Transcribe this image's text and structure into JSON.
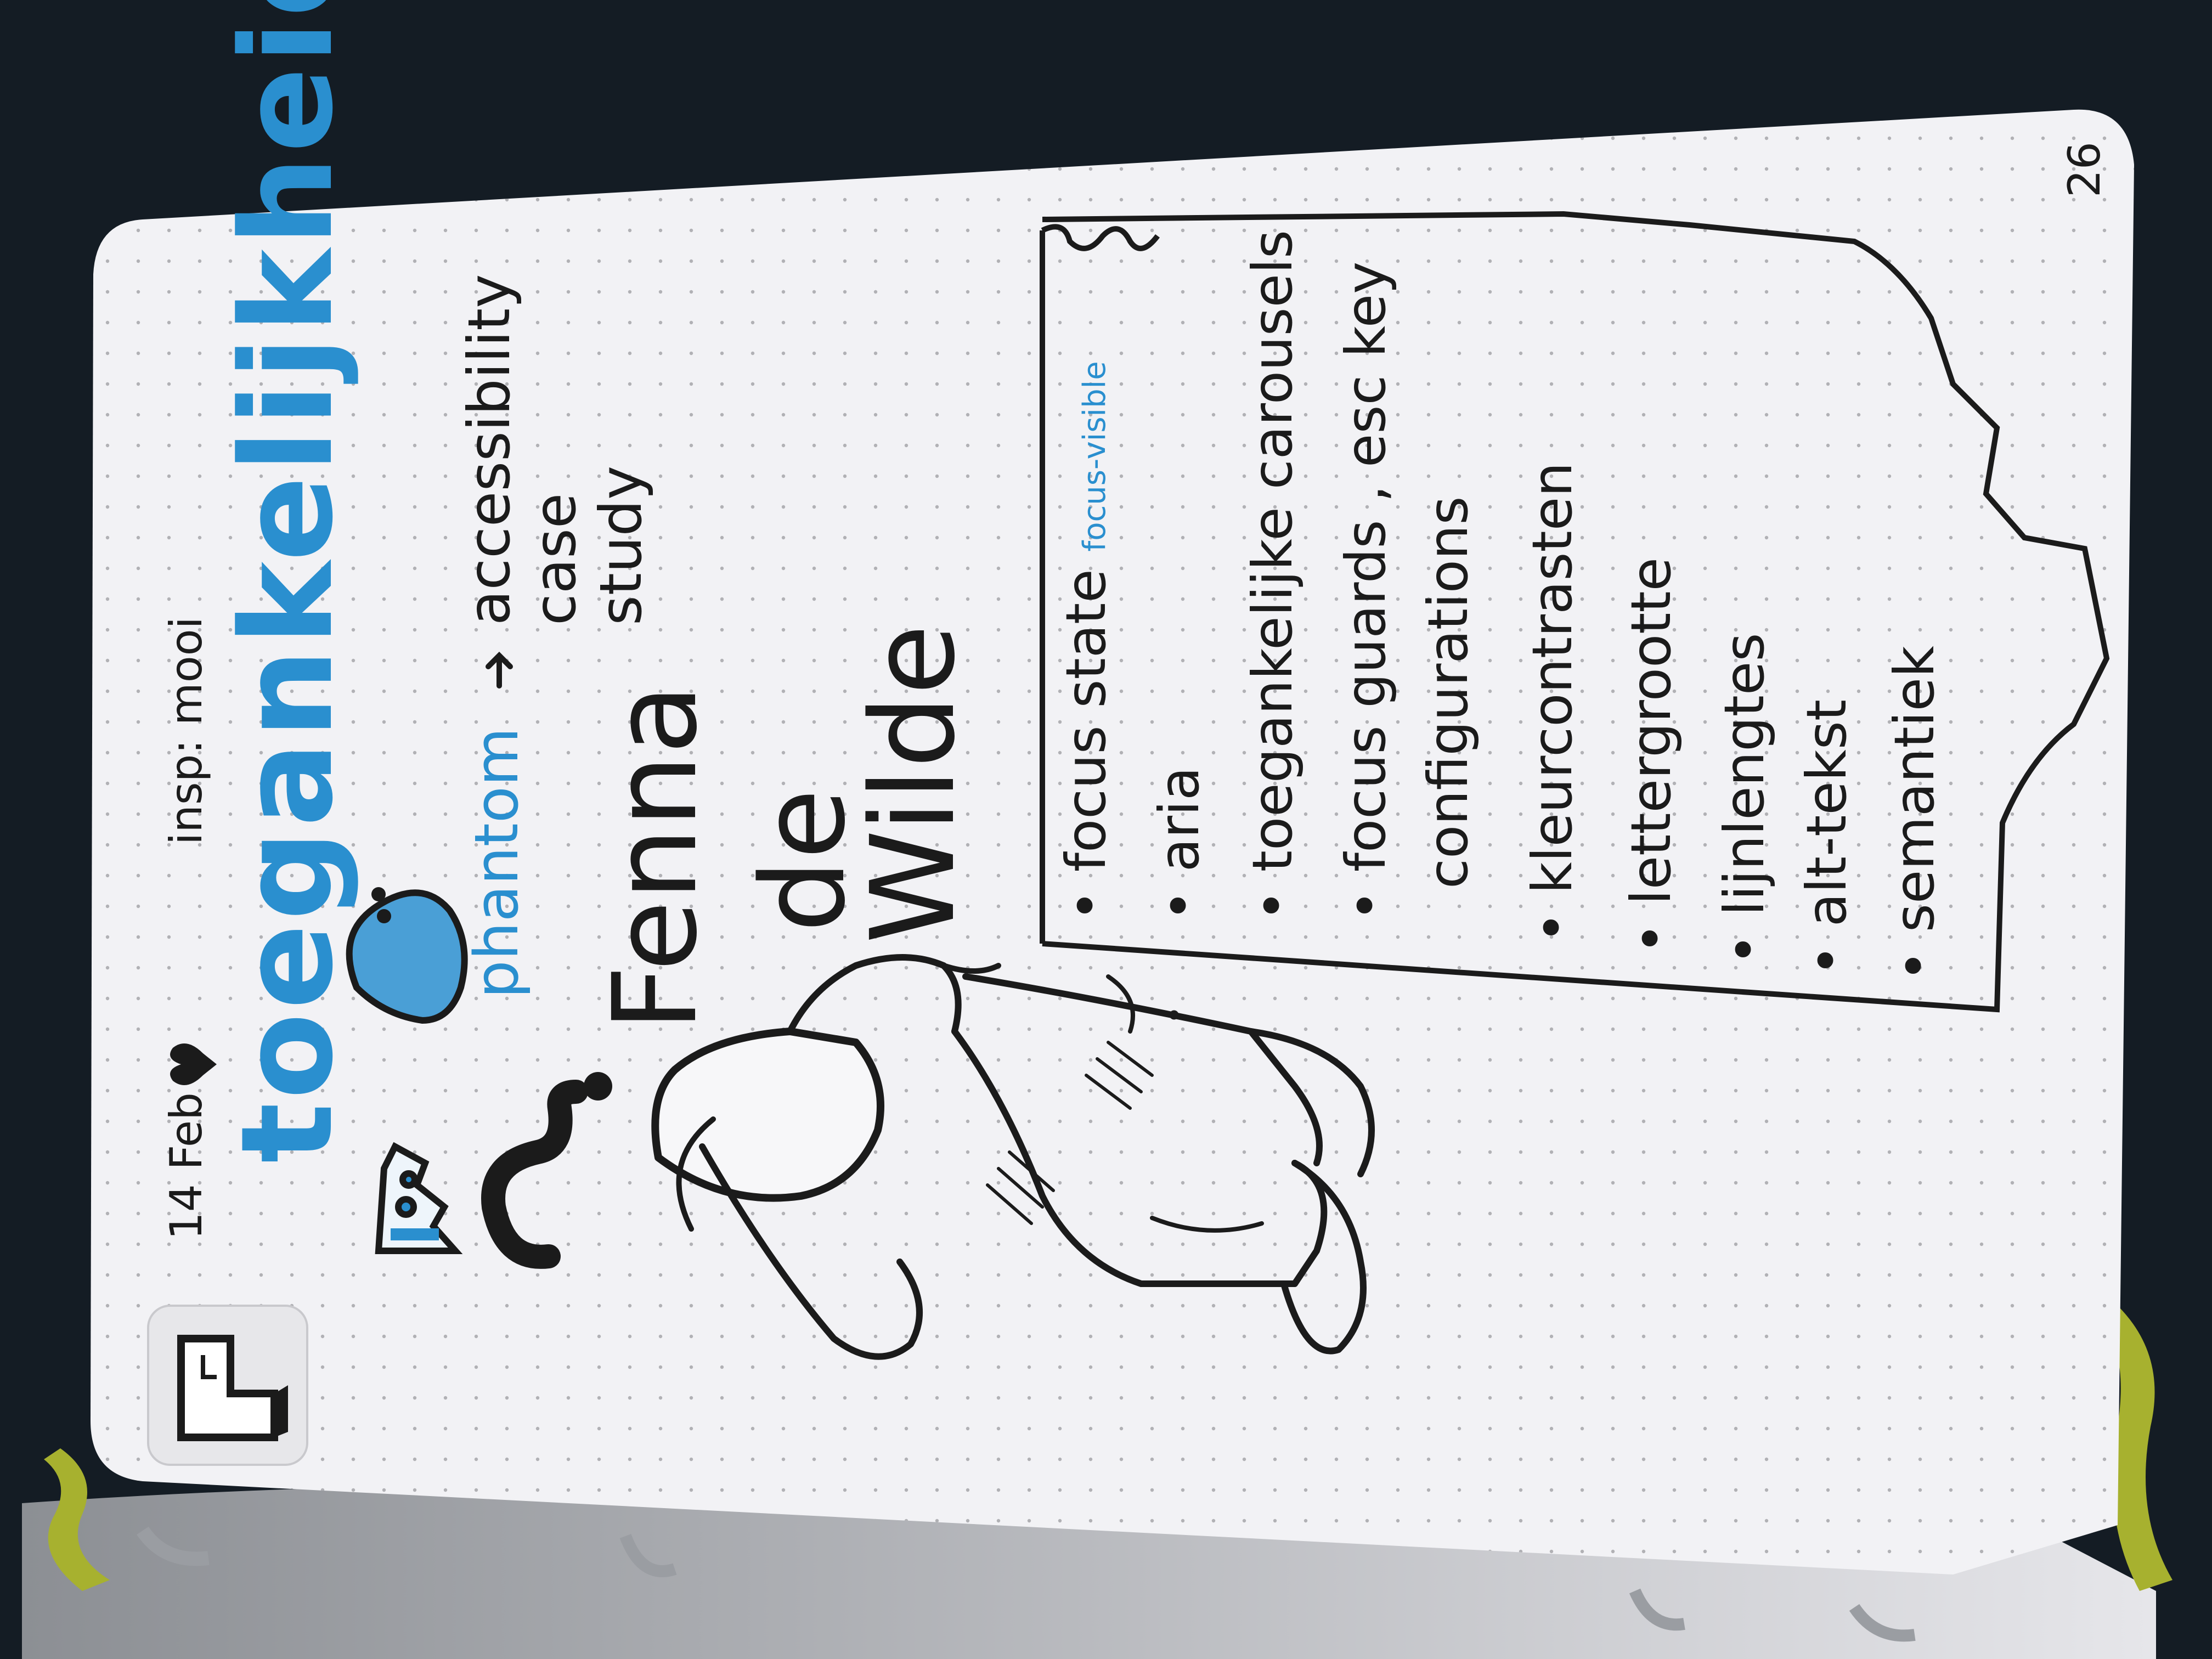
{
  "notebook": {
    "page_number": "26",
    "date": "14 Feb",
    "insp_note": "insp: mooi",
    "title": "toegankelijkheid",
    "phantom_label": "phantom",
    "arrow_note_lines": [
      "accessibility",
      "case",
      "study"
    ],
    "person_name_lines": [
      "Fenna",
      "de",
      "Wilde"
    ],
    "checklist": [
      {
        "label": "focus state",
        "annotation": "focus-visible"
      },
      {
        "label": "aria"
      },
      {
        "label": "toegankelijke carousels"
      },
      {
        "label": "focus guards , esc key",
        "continuation": "configurations"
      },
      {
        "label": "kleurcontrasten"
      },
      {
        "label": "lettergrootte"
      },
      {
        "label": "lijnlengtes"
      },
      {
        "label": "alt-tekst"
      },
      {
        "label": "semantiek"
      }
    ]
  },
  "colors": {
    "background": "#141c24",
    "paper": "#f2f2f5",
    "ink": "#1b1b1b",
    "accent_blue": "#2a8fcf",
    "ribbon": "#a7b12f",
    "dot": "#7c7c80"
  },
  "icons": [
    "crown-icon",
    "question-mark-icon",
    "heart-icon",
    "ghost-icon",
    "arrow-icon",
    "tetris-sticker-icon",
    "figure-sketch"
  ]
}
